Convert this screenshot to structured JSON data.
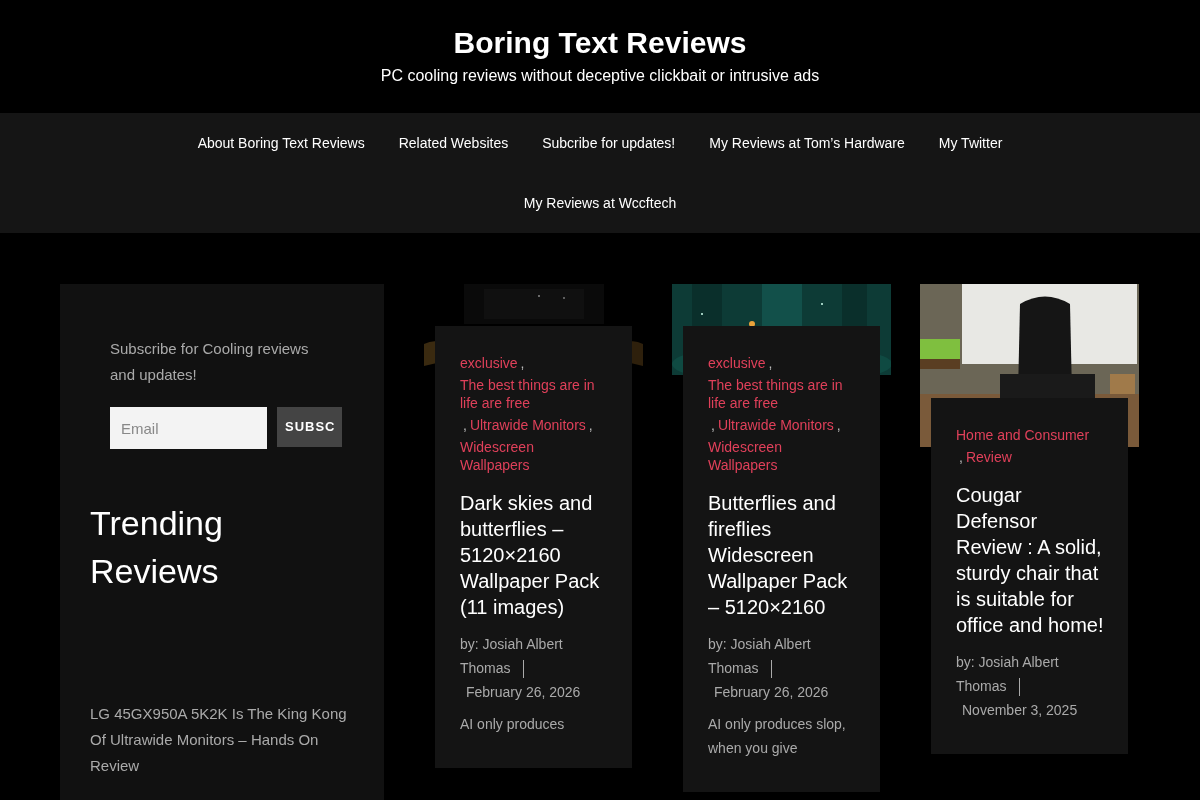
{
  "site": {
    "title": "Boring Text Reviews",
    "tagline": "PC cooling reviews without deceptive clickbait or intrusive ads"
  },
  "nav": {
    "items": [
      {
        "label": "About Boring Text Reviews"
      },
      {
        "label": "Related Websites"
      },
      {
        "label": "Subcribe for updates!"
      },
      {
        "label": "My Reviews at Tom’s Hardware"
      },
      {
        "label": "My Twitter"
      },
      {
        "label": "My Reviews at Wccftech"
      }
    ]
  },
  "sidebar": {
    "subscribe_text": "Subscribe for Cooling reviews and updates!",
    "email": {
      "placeholder": "Email"
    },
    "button": "SUBSC",
    "trending_title": "Trending Reviews",
    "trending": [
      {
        "title": "LG 45GX950A 5K2K Is The King Kong Of Ultrawide Monitors – Hands On Review"
      }
    ]
  },
  "posts": [
    {
      "categories": [
        {
          "name": "exclusive",
          "separator": ","
        },
        {
          "name": "The best things are in life are free",
          "separator": ","
        },
        {
          "name": "Ultrawide Monitors",
          "separator": ","
        },
        {
          "name": "Widescreen Wallpapers"
        }
      ],
      "title": "Dark skies and butterflies – 5120×2160 Wallpaper Pack (11 images)",
      "author": "by: Josiah Albert Thomas",
      "date": "February 26, 2026",
      "excerpt": "AI only produces"
    },
    {
      "categories": [
        {
          "name": "exclusive",
          "separator": ","
        },
        {
          "name": "The best things are in life are free",
          "separator": ","
        },
        {
          "name": "Ultrawide Monitors",
          "separator": ","
        },
        {
          "name": "Widescreen Wallpapers"
        }
      ],
      "title": "Butterflies and fireflies Widescreen Wallpaper Pack – 5120×2160",
      "author": "by: Josiah Albert Thomas",
      "date": "February 26, 2026",
      "excerpt": "AI only produces slop, when you give"
    },
    {
      "categories": [
        {
          "name": "Home and Consumer",
          "separator": ","
        },
        {
          "name": "Review"
        }
      ],
      "title": "Cougar Defensor Review : A solid, sturdy chair that is suitable for office and home!",
      "author": "by: Josiah Albert Thomas",
      "date": "November 3, 2025"
    }
  ]
}
